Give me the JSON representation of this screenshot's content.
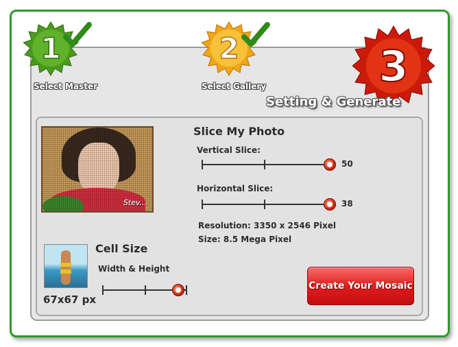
{
  "steps": [
    {
      "number": "1",
      "label": "Select Master",
      "color": "#4a9a1e",
      "completed": true
    },
    {
      "number": "2",
      "label": "Select Gallery",
      "color": "#f2a516",
      "completed": true
    },
    {
      "number": "3",
      "label": "Setting & Generate",
      "color": "#cc1a0a",
      "completed": false
    }
  ],
  "slice": {
    "title": "Slice My Photo",
    "vertical": {
      "label": "Vertical Slice:",
      "value": "50"
    },
    "horizontal": {
      "label": "Horizontal Slice:",
      "value": "38"
    },
    "resolution": "Resolution: 3350 x 2546 Pixel",
    "size": "Size: 8.5 Mega Pixel"
  },
  "cell": {
    "title": "Cell Size",
    "subtitle": "Width & Height",
    "size_text": "67x67 px"
  },
  "photo": {
    "watermark": "Stev..."
  },
  "create_button": "Create Your Mosaic",
  "colors": {
    "frame": "#2a9a2a",
    "accent": "#e01e1e"
  }
}
